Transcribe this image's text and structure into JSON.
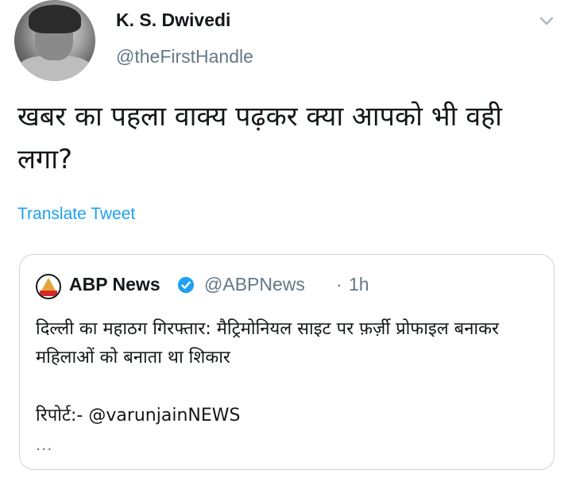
{
  "tweet": {
    "author": {
      "display_name": "K. S. Dwivedi",
      "handle": "@theFirstHandle"
    },
    "text": "खबर का पहला वाक्य पढ़कर क्या आपको भी वही लगा?",
    "translate_label": "Translate Tweet",
    "menu_icon": "chevron-down-icon"
  },
  "quoted_tweet": {
    "author": {
      "display_name": "ABP News",
      "handle": "@ABPNews",
      "verified": true
    },
    "separator": "·",
    "time": "1h",
    "text": "दिल्ली का महाठग गिरफ्तार: मैट्रिमोनियल साइट पर फ़र्ज़ी प्रोफाइल बनाकर महिलाओं को बनाता था शिकार",
    "report_line": "रिपोर्ट:- @varunjainNEWS",
    "truncation": "...",
    "verified_color": "#1da1f2"
  },
  "colors": {
    "link": "#1da1f2",
    "secondary_text": "#657786",
    "border": "#ccd6dd"
  }
}
